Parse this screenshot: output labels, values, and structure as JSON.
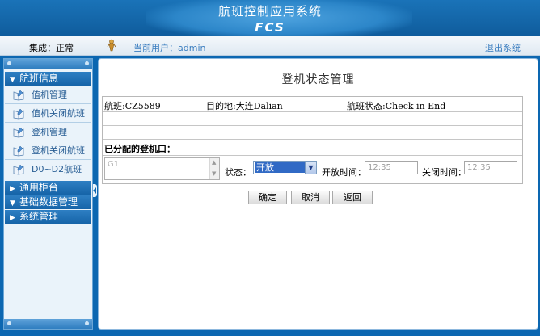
{
  "header": {
    "app_title": "航班控制应用系统",
    "logo_text": "FCS"
  },
  "statusbar": {
    "integration_status": "集成：正常",
    "current_user": "当前用户：admin",
    "logout": "退出系统"
  },
  "sidebar": {
    "sections": [
      {
        "label": "航班信息",
        "expanded": true
      },
      {
        "label": "通用柜台",
        "expanded": false
      },
      {
        "label": "基础数据管理",
        "expanded": true
      },
      {
        "label": "系统管理",
        "expanded": false
      }
    ],
    "items": [
      {
        "label": "值机管理",
        "icon": "book-pen-icon"
      },
      {
        "label": "值机关闭航班",
        "icon": "book-pen-icon"
      },
      {
        "label": "登机管理",
        "icon": "book-pen-icon"
      },
      {
        "label": "登机关闭航班",
        "icon": "book-pen-icon"
      },
      {
        "label": "D0~D2航班",
        "icon": "book-pen-icon"
      }
    ]
  },
  "main": {
    "page_title": "登机状态管理",
    "flight": "航班:CZ5589",
    "destination": "目的地:大连Dalian",
    "flight_status": "航班状态:Check in End",
    "assigned_gate_label": "已分配的登机口：",
    "gate_value": "G1",
    "status_label": "状态：",
    "status_value": "开放",
    "open_time_label": "开放时间：",
    "open_time_value": "12:35",
    "close_time_label": "关闭时间：",
    "close_time_value": "12:35"
  },
  "buttons": {
    "confirm": "确定",
    "cancel": "取消",
    "back": "返回"
  },
  "colors": {
    "header_blue": "#1a73b8",
    "frame_blue": "#0c67b1",
    "link_blue": "#3a7dbf",
    "select_highlight": "#316ac5"
  }
}
